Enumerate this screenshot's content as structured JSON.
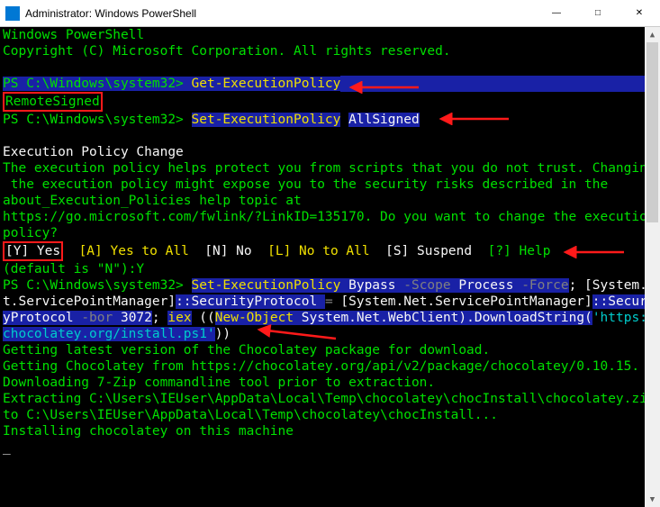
{
  "window": {
    "title": "Administrator: Windows PowerShell"
  },
  "shell": {
    "banner1": "Windows PowerShell",
    "banner2": "Copyright (C) Microsoft Corporation. All rights reserved."
  },
  "prompt": "PS C:\\Windows\\system32> ",
  "cmd1": "Get-ExecutionPolicy",
  "result1": "RemoteSigned",
  "cmd2a": "Set-ExecutionPolicy",
  "cmd2b": "AllSigned",
  "policy": {
    "title": "Execution Policy Change",
    "body": "The execution policy helps protect you from scripts that you do not trust. Changing\n the execution policy might expose you to the security risks described in the\nabout_Execution_Policies help topic at\nhttps://go.microsoft.com/fwlink/?LinkID=135170. Do you want to change the execution\npolicy?",
    "options": {
      "y": "[Y] Yes",
      "a": "[A] Yes to All",
      "n": "[N] No",
      "l": "[L] No to All",
      "s": "[S] Suspend",
      "h": "[?] Help"
    },
    "default": "(default is \"N\"):",
    "answer": "Y"
  },
  "cmd3": {
    "p1a": "Set-ExecutionPolicy",
    "p1b": " Bypass ",
    "p1c": "-Scope",
    "p1d": " Process ",
    "p1e": "-Force",
    "p1f": "; [System.Ne",
    "p2a": "t.ServicePointManager]",
    "p2b": "::SecurityProtocol ",
    "p2c": "=",
    "p2d": " [System.Net.ServicePointManager]",
    "p2e": "::Securit",
    "p3a": "yProtocol ",
    "p3b": "-bor",
    "p3c": " 3072",
    "p3d": "; ",
    "p3e": "iex",
    "p3f": " ((",
    "p3g": "New-Object",
    "p3h": " System.Net.WebClient).DownloadString(",
    "p3i": "'https://",
    "p4a": "chocolatey.org/install.ps1'",
    "p4b": "))"
  },
  "output": {
    "l1": "Getting latest version of the Chocolatey package for download.",
    "l2": "Getting Chocolatey from https://chocolatey.org/api/v2/package/chocolatey/0.10.15.",
    "l3": "Downloading 7-Zip commandline tool prior to extraction.",
    "l4": "Extracting C:\\Users\\IEUser\\AppData\\Local\\Temp\\chocolatey\\chocInstall\\chocolatey.zip",
    "l5": "to C:\\Users\\IEUser\\AppData\\Local\\Temp\\chocolatey\\chocInstall...",
    "l6": "Installing chocolatey on this machine"
  }
}
